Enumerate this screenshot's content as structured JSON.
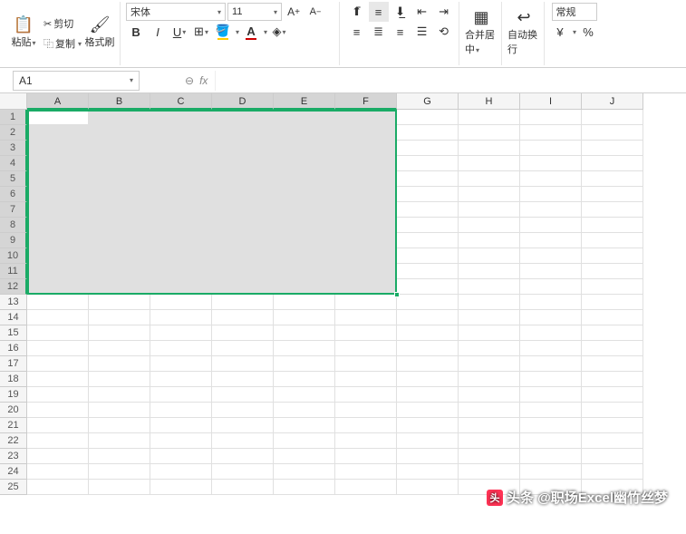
{
  "ribbon": {
    "clipboard": {
      "paste": "粘贴",
      "cut": "剪切",
      "copy": "复制",
      "format_painter": "格式刷"
    },
    "font": {
      "name": "宋体",
      "size": "11",
      "inc": "A⁺",
      "dec": "A⁻"
    },
    "merge": {
      "label": "合并居中"
    },
    "wrap": {
      "label": "自动换行"
    },
    "number": {
      "label": "常规",
      "currency": "¥",
      "percent": "%"
    }
  },
  "namebox": "A1",
  "columns": [
    "A",
    "B",
    "C",
    "D",
    "E",
    "F",
    "G",
    "H",
    "I",
    "J"
  ],
  "sel_cols": 6,
  "rows": 25,
  "sel_rows": 12,
  "watermark": "头条 @职场Excel幽竹丝梦"
}
